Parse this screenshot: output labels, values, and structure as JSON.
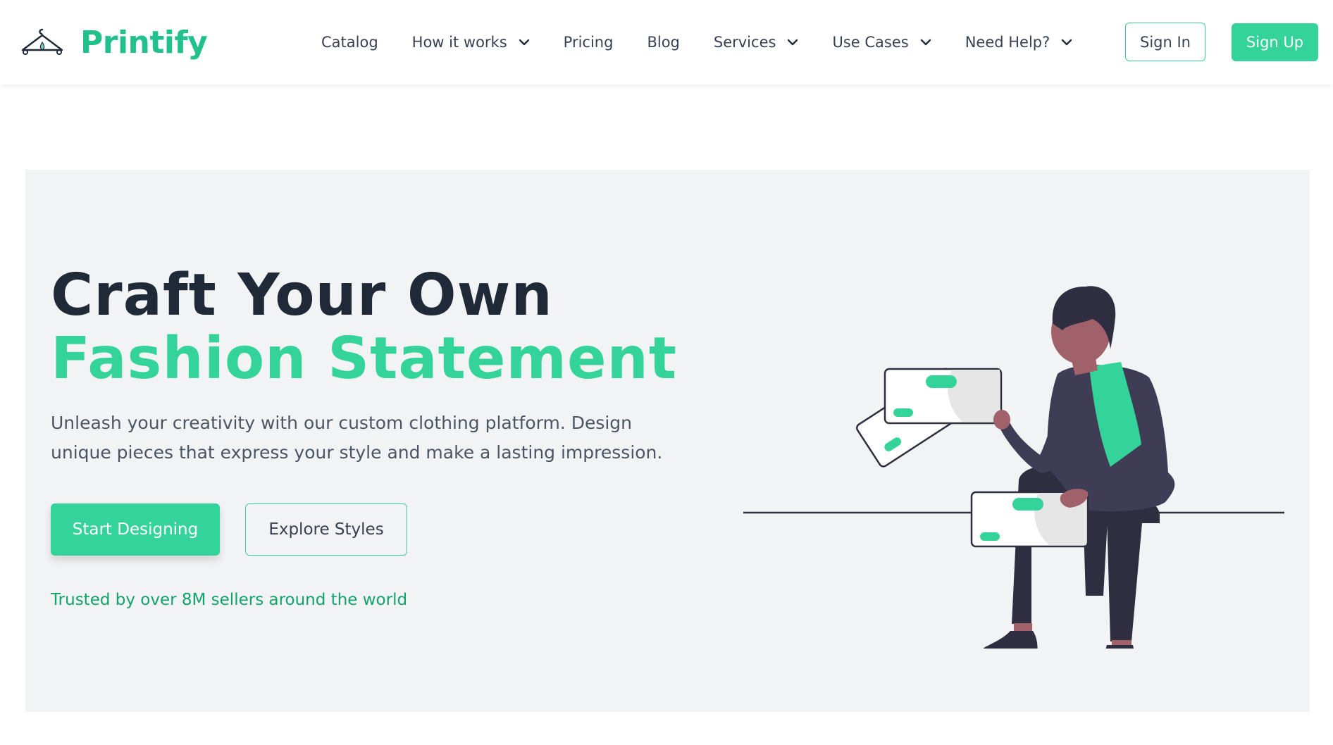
{
  "brand": {
    "name": "Printify",
    "logo_icon": "hanger-icon",
    "accent_color": "#34d399",
    "dark_text_color": "#1f2937"
  },
  "nav": {
    "items": [
      {
        "label": "Catalog",
        "has_dropdown": false
      },
      {
        "label": "How it works",
        "has_dropdown": true
      },
      {
        "label": "Pricing",
        "has_dropdown": false
      },
      {
        "label": "Blog",
        "has_dropdown": false
      },
      {
        "label": "Services",
        "has_dropdown": true
      },
      {
        "label": "Use Cases",
        "has_dropdown": true
      },
      {
        "label": "Need Help?",
        "has_dropdown": true
      }
    ]
  },
  "auth": {
    "sign_in": "Sign In",
    "sign_up": "Sign Up"
  },
  "hero": {
    "title_line1": "Craft Your Own",
    "title_line2": "Fashion Statement",
    "subtitle": "Unleash your creativity with our custom clothing platform. Design unique pieces that express your style and make a lasting impression.",
    "primary_cta": "Start Designing",
    "secondary_cta": "Explore Styles",
    "trust_text": "Trusted by over 8M sellers around the world",
    "illustration": "person-sitting-with-cards-illustration"
  }
}
